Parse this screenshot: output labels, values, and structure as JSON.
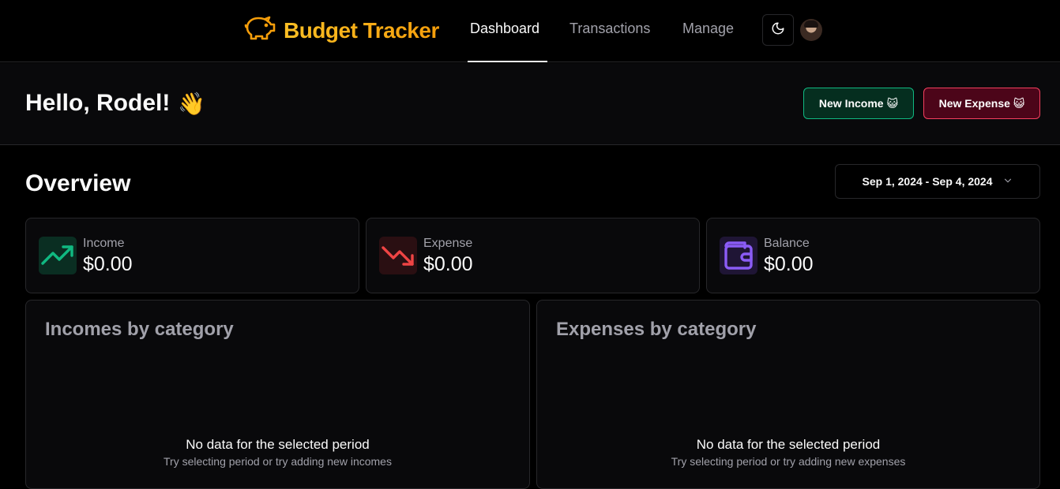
{
  "header": {
    "brand": "Budget Tracker",
    "nav": [
      {
        "label": "Dashboard",
        "active": true
      },
      {
        "label": "Transactions",
        "active": false
      },
      {
        "label": "Manage",
        "active": false
      }
    ],
    "icons": {
      "logo": "piggy-bank-icon",
      "theme": "moon-icon",
      "avatar": "user-avatar"
    }
  },
  "greeting": {
    "text": "Hello, Rodel!",
    "emoji": "👋",
    "new_income_label": "New Income 😺",
    "new_expense_label": "New Expense 😺"
  },
  "overview": {
    "title": "Overview",
    "date_range": "Sep 1, 2024 - Sep 4, 2024",
    "stats": [
      {
        "label": "Income",
        "value": "$0.00",
        "icon": "trending-up-icon",
        "color": "#10b981"
      },
      {
        "label": "Expense",
        "value": "$0.00",
        "icon": "trending-down-icon",
        "color": "#ef4444"
      },
      {
        "label": "Balance",
        "value": "$0.00",
        "icon": "wallet-icon",
        "color": "#8b5cf6"
      }
    ]
  },
  "categories": {
    "income": {
      "title": "Incomes by category",
      "empty_title": "No data for the selected period",
      "empty_sub": "Try selecting period or try adding new incomes"
    },
    "expense": {
      "title": "Expenses by category",
      "empty_title": "No data for the selected period",
      "empty_sub": "Try selecting period or try adding new expenses"
    }
  },
  "colors": {
    "brand": "#f59e0b",
    "income": "#10b981",
    "expense": "#f43f5e",
    "balance": "#8b5cf6"
  }
}
